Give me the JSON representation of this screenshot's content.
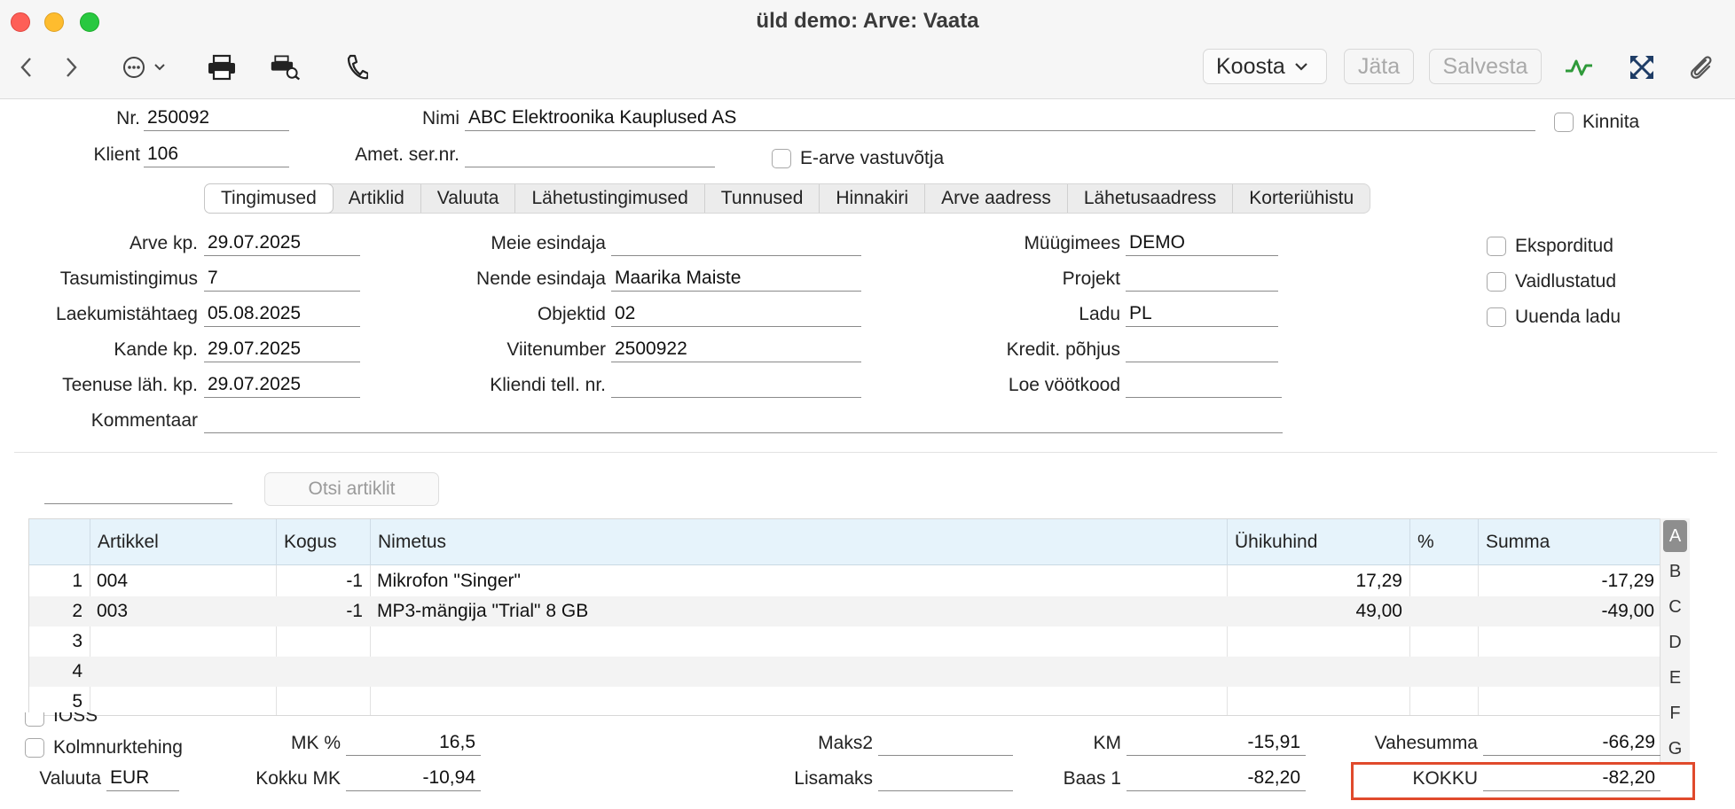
{
  "window": {
    "title": "üld demo: Arve: Vaata"
  },
  "toolbar": {
    "koosta": "Koosta",
    "jata": "Jäta",
    "salvesta": "Salvesta"
  },
  "header": {
    "nr_label": "Nr.",
    "nr": "250092",
    "nimi_label": "Nimi",
    "nimi": "ABC Elektroonika Kauplused AS",
    "kinnita": "Kinnita",
    "klient_label": "Klient",
    "klient": "106",
    "amet_label": "Amet. ser.nr.",
    "amet": "",
    "earve": "E-arve vastuvõtja"
  },
  "tabs": [
    "Tingimused",
    "Artiklid",
    "Valuuta",
    "Lähetustingimused",
    "Tunnused",
    "Hinnakiri",
    "Arve aadress",
    "Lähetusaadress",
    "Korteriühistu"
  ],
  "form": {
    "arve_kp_label": "Arve kp.",
    "arve_kp": "29.07.2025",
    "tasum_label": "Tasumistingimus",
    "tasum": "7",
    "laekum_label": "Laekumistähtaeg",
    "laekum": "05.08.2025",
    "kande_label": "Kande kp.",
    "kande": "29.07.2025",
    "teenuse_label": "Teenuse läh. kp.",
    "teenuse": "29.07.2025",
    "komm_label": "Kommentaar",
    "komm": "",
    "meie_label": "Meie esindaja",
    "meie": "",
    "nende_label": "Nende esindaja",
    "nende": "Maarika Maiste",
    "objektid_label": "Objektid",
    "objektid": "02",
    "viite_label": "Viitenumber",
    "viite": "2500922",
    "kliendi_label": "Kliendi tell. nr.",
    "kliendi": "",
    "muugi_label": "Müügimees",
    "muugi": "DEMO",
    "projekt_label": "Projekt",
    "projekt": "",
    "ladu_label": "Ladu",
    "ladu": "PL",
    "kredit_label": "Kredit. põhjus",
    "kredit": "",
    "loe_label": "Loe vöötkood",
    "loe": "",
    "eksp": "Eksporditud",
    "vaid": "Vaidlustatud",
    "uuenda": "Uuenda ladu"
  },
  "search": {
    "button": "Otsi artiklit"
  },
  "grid": {
    "headers": [
      "Artikkel",
      "Kogus",
      "Nimetus",
      "Ühikuhind",
      "%",
      "Summa"
    ],
    "rows": [
      {
        "n": "1",
        "art": "004",
        "kogus": "-1",
        "nim": "Mikrofon \"Singer\"",
        "hind": "17,29",
        "pct": "",
        "summa": "-17,29"
      },
      {
        "n": "2",
        "art": "003",
        "kogus": "-1",
        "nim": "MP3-mängija \"Trial\" 8 GB",
        "hind": "49,00",
        "pct": "",
        "summa": "-49,00"
      },
      {
        "n": "3",
        "art": "",
        "kogus": "",
        "nim": "",
        "hind": "",
        "pct": "",
        "summa": ""
      },
      {
        "n": "4",
        "art": "",
        "kogus": "",
        "nim": "",
        "hind": "",
        "pct": "",
        "summa": ""
      },
      {
        "n": "5",
        "art": "",
        "kogus": "",
        "nim": "",
        "hind": "",
        "pct": "",
        "summa": ""
      }
    ],
    "letters": [
      "A",
      "B",
      "C",
      "D",
      "E",
      "F",
      "G"
    ]
  },
  "footer": {
    "ioss": "IOSS",
    "kolm": "Kolmnurktehing",
    "valuuta_label": "Valuuta",
    "valuuta": "EUR",
    "mk_label": "MK %",
    "mk": "16,5",
    "kokku_mk_label": "Kokku MK",
    "kokku_mk": "-10,94",
    "maks2_label": "Maks2",
    "maks2": "",
    "lisamaks_label": "Lisamaks",
    "lisamaks": "",
    "km_label": "KM",
    "km": "-15,91",
    "baas_label": "Baas 1",
    "baas": "-82,20",
    "vahe_label": "Vahesumma",
    "vahe": "-66,29",
    "kokku_label": "KOKKU",
    "kokku": "-82,20"
  }
}
